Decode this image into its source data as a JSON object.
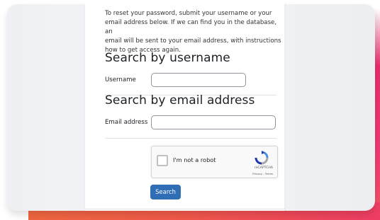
{
  "instructions": {
    "lines": [
      "To reset your password, submit your username or your",
      "email address below. If we can find you in the database, an",
      "email will be sent to your email address, with instructions",
      "how to get access again."
    ]
  },
  "username_section": {
    "heading": "Search by username",
    "label": "Username",
    "value": ""
  },
  "email_section": {
    "heading": "Search by email address",
    "label": "Email address",
    "value": ""
  },
  "recaptcha": {
    "label": "I'm not a robot",
    "brand": "reCAPTCHA",
    "links": "Privacy - Terms"
  },
  "search_button": {
    "label": "Search"
  },
  "colors": {
    "button": "#2f6db5",
    "accent_pink": "#e62d6b",
    "accent_orange": "#f06a3e"
  }
}
